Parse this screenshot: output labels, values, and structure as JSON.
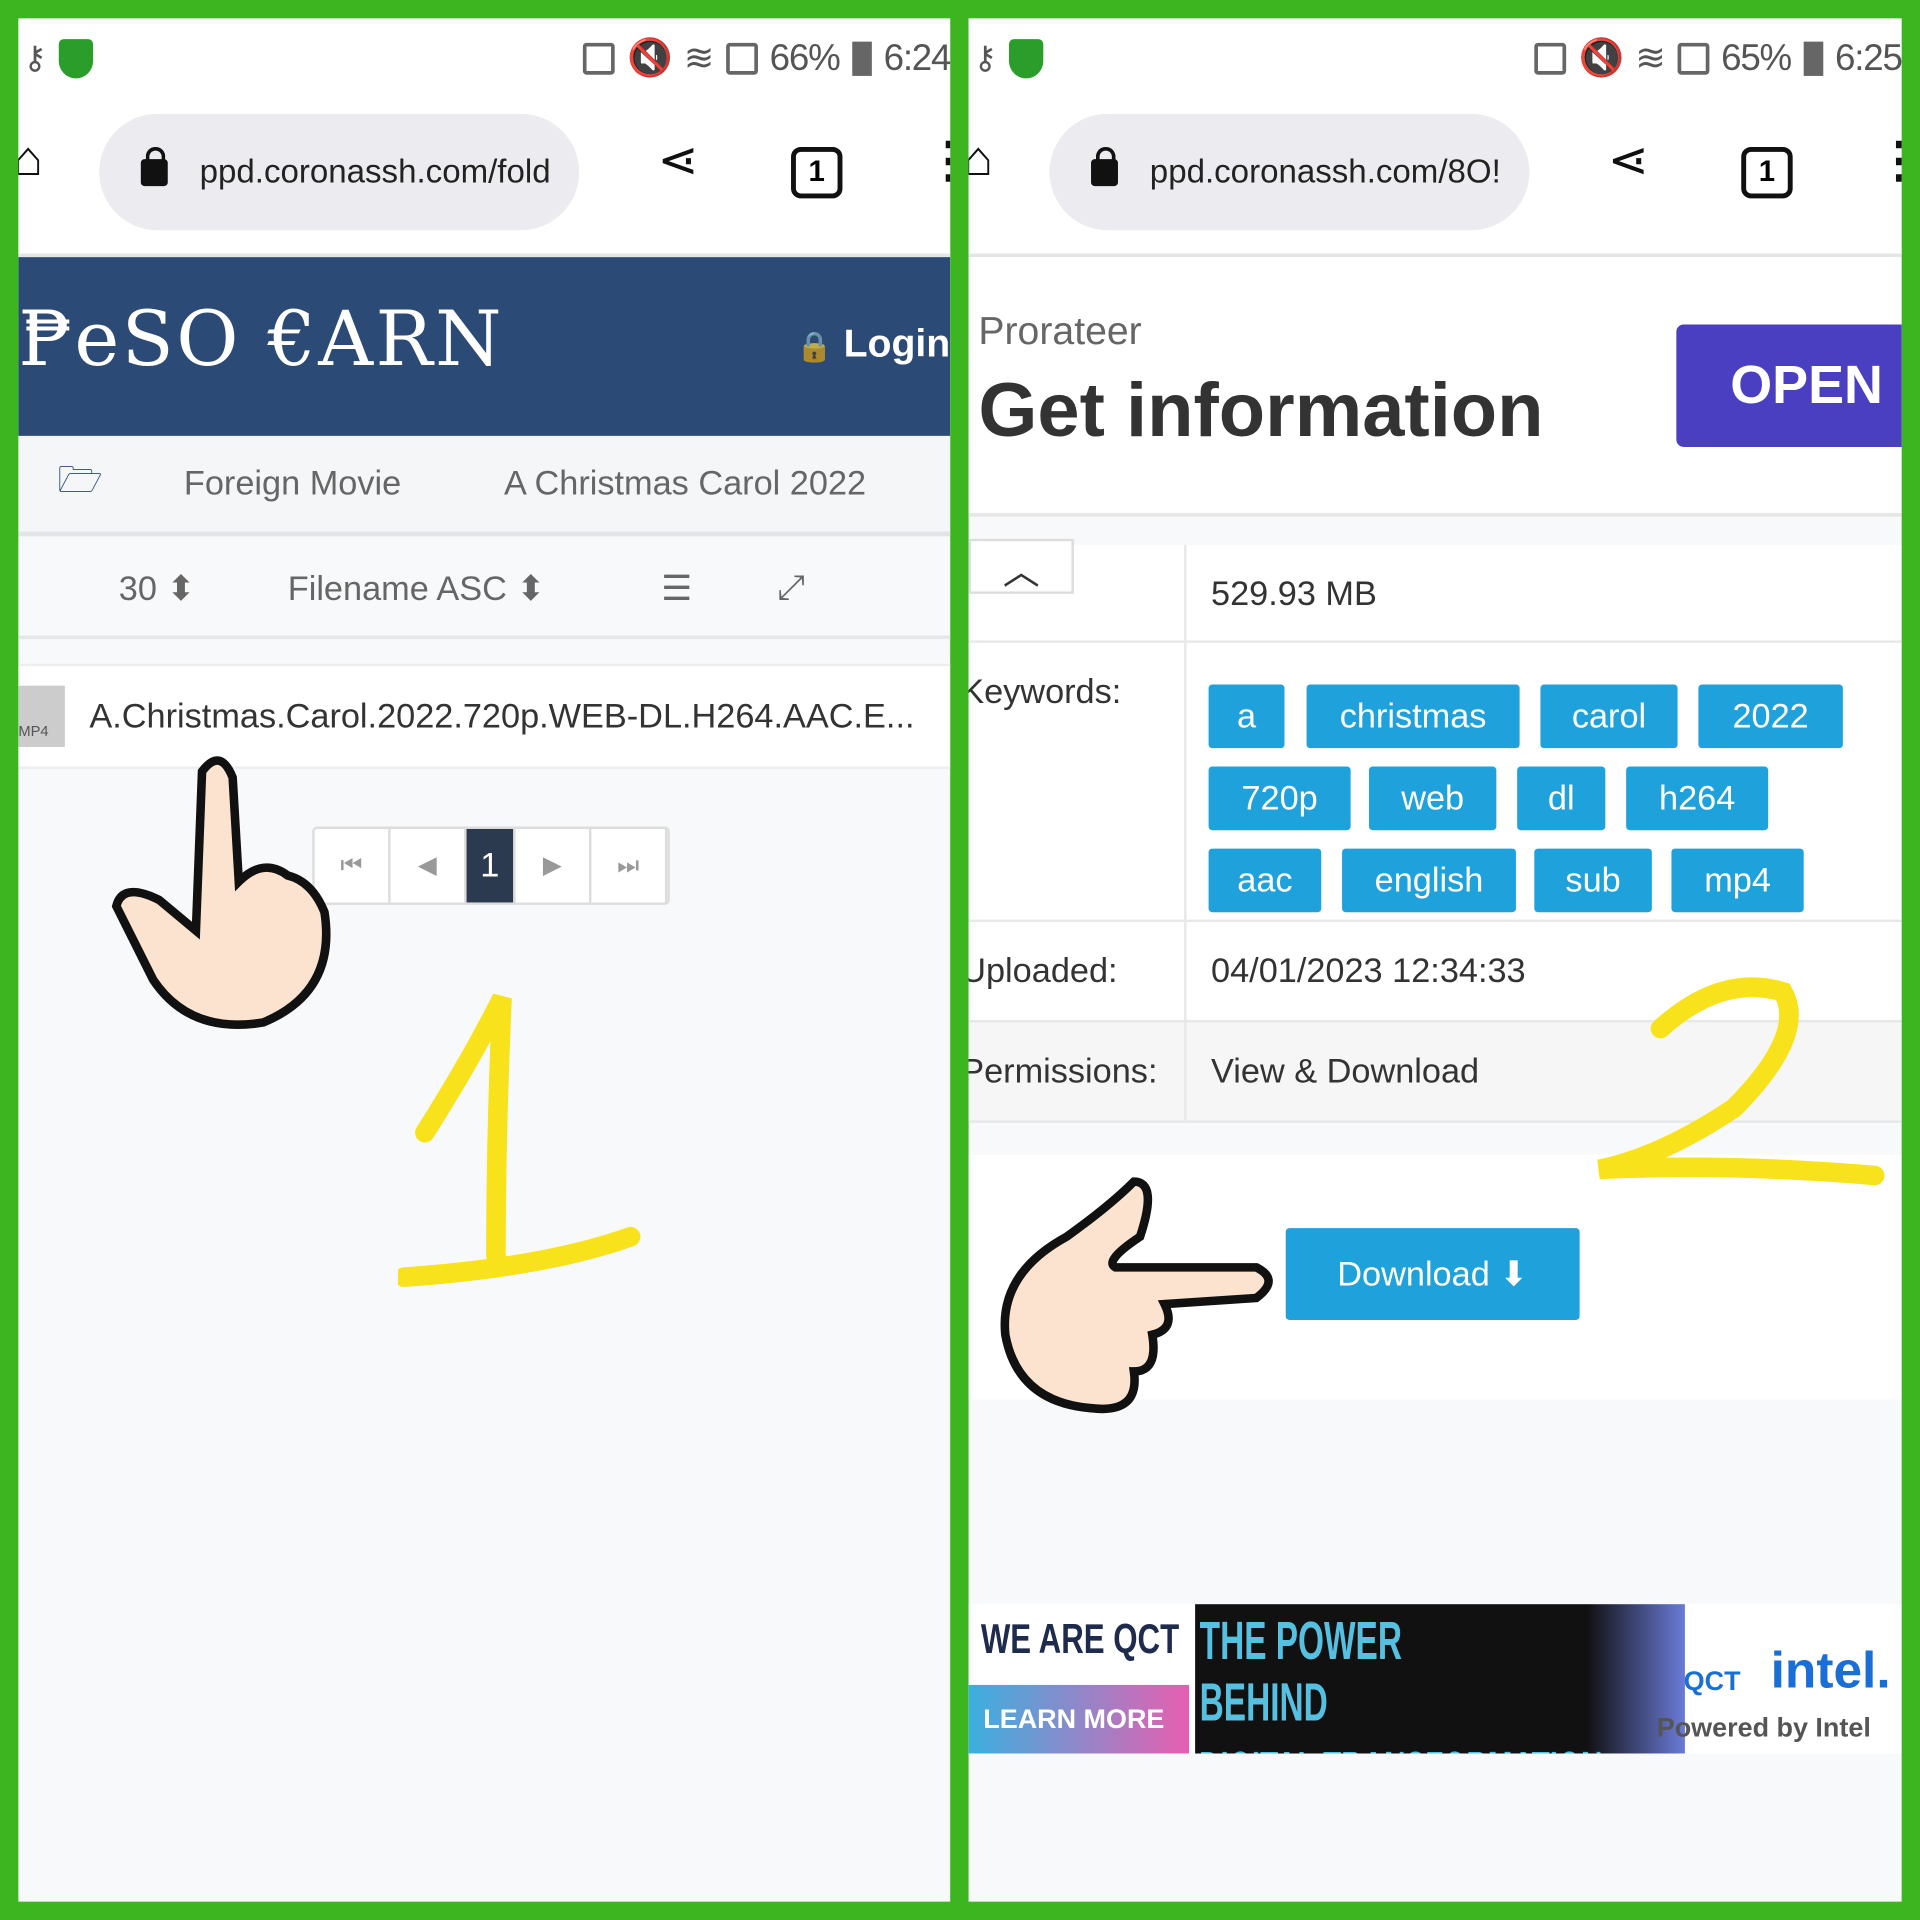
{
  "left": {
    "status": {
      "battery": "66%",
      "time": "6:24"
    },
    "url": "ppd.coronassh.com/fold",
    "tab_count": "1",
    "site_logo": "₱eSO €ARN",
    "login_label": "Login",
    "breadcrumb": [
      "Foreign Movie",
      "A Christmas Carol 2022"
    ],
    "toolbar": {
      "per_page": "30",
      "sort": "Filename ASC"
    },
    "file": {
      "badge": "MP4",
      "name": "A.Christmas.Carol.2022.720p.WEB-DL.H264.AAC.E..."
    },
    "pagination": {
      "current": "1"
    },
    "annotation": "1"
  },
  "right": {
    "status": {
      "battery": "65%",
      "time": "6:25"
    },
    "url": "ppd.coronassh.com/8O!",
    "tab_count": "1",
    "ad": {
      "brand": "Prorateer",
      "headline": "Get information",
      "button": "OPEN"
    },
    "details": {
      "size_value": "529.93 MB",
      "keywords_label": "Keywords:",
      "keywords": [
        "a",
        "christmas",
        "carol",
        "2022",
        "720p",
        "web",
        "dl",
        "h264",
        "aac",
        "english",
        "sub",
        "mp4"
      ],
      "uploaded_label": "Uploaded:",
      "uploaded_value": "04/01/2023 12:34:33",
      "permissions_label": "Permissions:",
      "permissions_value": "View & Download"
    },
    "download_label": "Download",
    "banner": {
      "t1": "WE ARE QCT",
      "t2": "LEARN MORE",
      "t3": "THE POWER BEHIND",
      "t4": "DIGITAL TRANSFORMATION",
      "t5": "intel.",
      "t6": "QCT",
      "t7": "Powered by Intel"
    },
    "annotation": "2"
  },
  "colors": {
    "frame": "#3cb521",
    "header": "#2b4a75",
    "tag": "#1fa2dc",
    "ad_button": "#4a3fc1",
    "annotation": "#f7e21b"
  }
}
